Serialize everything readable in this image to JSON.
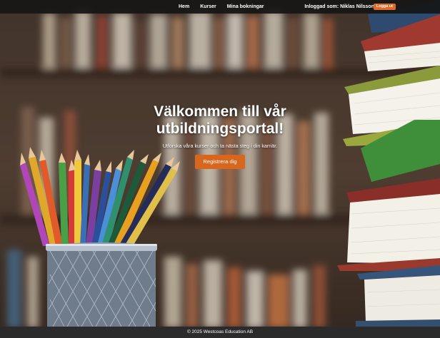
{
  "nav": {
    "links": [
      "Hem",
      "Kurser",
      "Mina bokningar"
    ],
    "user_label": "Inloggad som: Niklas Nilsson",
    "logout_label": "Logga ut"
  },
  "hero": {
    "title_line1": "Välkommen till vår",
    "title_line2": "utbildningsportal!",
    "subtitle": "Utforska våra kurser och ta nästa steg i din karriär.",
    "cta_label": "Registrera dig"
  },
  "footer": {
    "text": "© 2025 Westcoas Education AB"
  },
  "colors": {
    "accent": "#d9661d",
    "navbar": "#161616",
    "footer": "#2b2b2b"
  },
  "icons": {
    "background": "library-books-pencils-image"
  }
}
